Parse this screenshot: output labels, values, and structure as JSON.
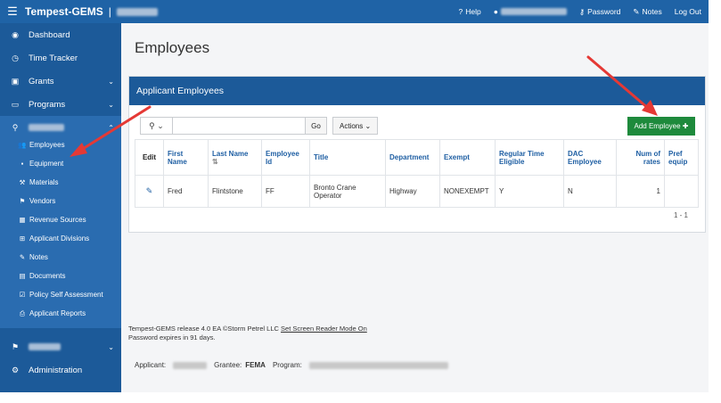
{
  "topbar": {
    "app_title": "Tempest-GEMS",
    "separator": "|",
    "help_label": "Help",
    "password_label": "Password",
    "notes_label": "Notes",
    "logout_label": "Log Out"
  },
  "sidebar": {
    "items": [
      {
        "label": "Dashboard",
        "icon": "dashboard-icon"
      },
      {
        "label": "Time Tracker",
        "icon": "clock-icon"
      },
      {
        "label": "Grants",
        "icon": "grants-icon"
      },
      {
        "label": "Programs",
        "icon": "folder-icon"
      }
    ],
    "sub_items": [
      {
        "label": "Employees",
        "icon": "users-icon"
      },
      {
        "label": "Equipment",
        "icon": "truck-icon"
      },
      {
        "label": "Materials",
        "icon": "wrench-icon"
      },
      {
        "label": "Vendors",
        "icon": "vendors-icon"
      },
      {
        "label": "Revenue Sources",
        "icon": "revenue-icon"
      },
      {
        "label": "Applicant Divisions",
        "icon": "divisions-icon"
      },
      {
        "label": "Notes",
        "icon": "edit-icon"
      },
      {
        "label": "Documents",
        "icon": "document-icon"
      },
      {
        "label": "Policy Self Assessment",
        "icon": "checklist-icon"
      },
      {
        "label": "Applicant Reports",
        "icon": "print-icon"
      }
    ],
    "administration_label": "Administration"
  },
  "main": {
    "page_title": "Employees",
    "region_title": "Applicant Employees",
    "search_placeholder": "",
    "go_label": "Go",
    "actions_label": "Actions",
    "add_button_label": "Add Employee",
    "table": {
      "headers": [
        "Edit",
        "First Name",
        "Last Name",
        "Employee Id",
        "Title",
        "Department",
        "Exempt",
        "Regular Time Eligible",
        "DAC Employee",
        "Num of rates",
        "Pref equip"
      ],
      "rows": [
        [
          "",
          "Fred",
          "Flintstone",
          "FF",
          "Bronto Crane Operator",
          "Highway",
          "NONEXEMPT",
          "Y",
          "N",
          "1",
          ""
        ]
      ]
    },
    "pagination": "1 - 1"
  },
  "footer": {
    "release_text": "Tempest-GEMS release 4.0 EA ©Storm Petrel LLC",
    "screen_reader_link": "Set Screen Reader Mode On",
    "password_expiry": "Password expires in 91 days.",
    "applicant_label": "Applicant:",
    "grantee_label": "Grantee:",
    "grantee_value": "FEMA",
    "program_label": "Program:"
  },
  "colors": {
    "header_blue": "#1f63a6",
    "sidebar_blue": "#1c5a99",
    "add_button_green": "#1e8a3c",
    "arrow_red": "#e53935"
  }
}
